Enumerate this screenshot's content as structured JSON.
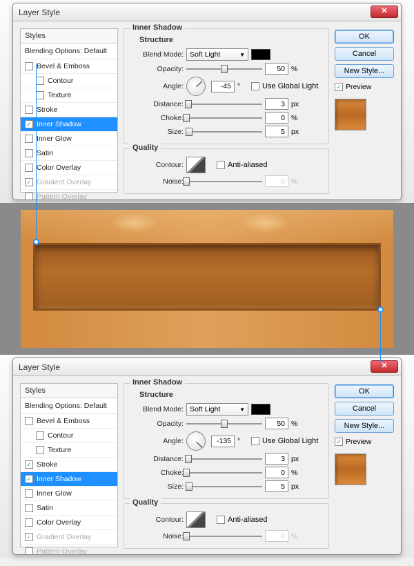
{
  "dialog_title": "Layer Style",
  "styles_header": "Styles",
  "blending_default": "Blending Options: Default",
  "style_list": {
    "bevel": "Bevel & Emboss",
    "contour": "Contour",
    "texture": "Texture",
    "stroke": "Stroke",
    "inner_shadow": "Inner Shadow",
    "inner_glow": "Inner Glow",
    "satin": "Satin",
    "color_overlay": "Color Overlay",
    "gradient_overlay": "Gradient Overlay",
    "pattern_overlay": "Pattern Overlay"
  },
  "group_title": "Inner Shadow",
  "structure": "Structure",
  "quality": "Quality",
  "labels": {
    "blend_mode": "Blend Mode:",
    "opacity": "Opacity:",
    "angle": "Angle:",
    "distance": "Distance:",
    "choke": "Choke:",
    "size": "Size:",
    "contour": "Contour:",
    "noise": "Noise:",
    "use_global": "Use Global Light",
    "anti_aliased": "Anti-aliased",
    "degree": "°",
    "percent": "%",
    "px": "px"
  },
  "top": {
    "blend_mode_value": "Soft Light",
    "opacity": "50",
    "angle": "-45",
    "distance": "3",
    "choke": "0",
    "size": "5",
    "noise": "0",
    "stroke_checked": false
  },
  "bottom": {
    "blend_mode_value": "Soft Light",
    "opacity": "50",
    "angle": "-135",
    "distance": "3",
    "choke": "0",
    "size": "5",
    "noise": "0",
    "stroke_checked": true
  },
  "buttons": {
    "ok": "OK",
    "cancel": "Cancel",
    "new_style": "New Style...",
    "preview": "Preview"
  },
  "colors": {
    "accent": "#1e90ff",
    "swatch_black": "#000000",
    "preview_wood": "#c6783a"
  }
}
